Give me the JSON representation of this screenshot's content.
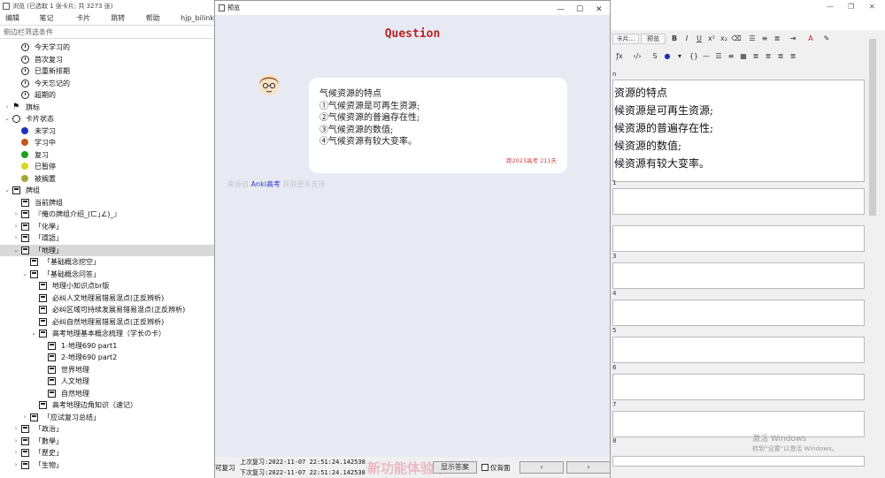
{
  "browser": {
    "title": "浏览 (已选取 1 张卡片; 共 3273 张)",
    "menu": [
      "编辑(E)",
      "笔记 (N)",
      "卡片(C)",
      "跳转(G)",
      "帮助(H)",
      "hjp_bilink"
    ],
    "sidebar_filter_placeholder": "侧边栏筛选条件",
    "tree": [
      {
        "label": "今天学习的",
        "icon": "clock-icon",
        "indent": 24
      },
      {
        "label": "首次复习",
        "icon": "clock-icon",
        "indent": 24
      },
      {
        "label": "已重新排期",
        "icon": "clock-icon",
        "indent": 24
      },
      {
        "label": "今天忘记的",
        "icon": "clock-icon",
        "indent": 24
      },
      {
        "label": "超期的",
        "icon": "clock-icon",
        "indent": 24
      },
      {
        "label": "旗标",
        "icon": "flag-icon",
        "indent": 14,
        "arrow": "›"
      },
      {
        "label": "卡片状态",
        "icon": "circle-icon",
        "indent": 14,
        "arrow": "⌄"
      },
      {
        "label": "未学习",
        "icon": "blue-dot-icon",
        "indent": 24
      },
      {
        "label": "学习中",
        "icon": "orange-dot-icon",
        "indent": 24
      },
      {
        "label": "复习",
        "icon": "green-dot-icon",
        "indent": 24
      },
      {
        "label": "已暂停",
        "icon": "yellow-dot-icon",
        "indent": 24
      },
      {
        "label": "被搁置",
        "icon": "olive-dot-icon",
        "indent": 24
      },
      {
        "label": "牌组",
        "icon": "deck-icon",
        "indent": 14,
        "arrow": "⌄"
      },
      {
        "label": "当前牌组",
        "icon": "current-deck-icon",
        "indent": 24
      },
      {
        "label": "『俺の牌组介绍_(ㄈ｣∠)_』",
        "icon": "deck-icon",
        "indent": 24,
        "arrow": "›"
      },
      {
        "label": "「化學」",
        "icon": "deck-icon",
        "indent": 24,
        "arrow": "›"
      },
      {
        "label": "「環語」",
        "icon": "deck-icon",
        "indent": 24,
        "arrow": "›"
      },
      {
        "label": "「地理」",
        "icon": "deck-icon",
        "indent": 24,
        "arrow": "⌄",
        "selected": true
      },
      {
        "label": "「基础概念挖空」",
        "icon": "deck-icon",
        "indent": 34
      },
      {
        "label": "「基础概念问答」",
        "icon": "deck-icon",
        "indent": 34,
        "arrow": "⌄"
      },
      {
        "label": "地理小知识点br版",
        "icon": "deck-icon",
        "indent": 44
      },
      {
        "label": "必纠人文地理易错易混点(正反辨析)",
        "icon": "deck-icon",
        "indent": 44
      },
      {
        "label": "必纠区域可持续发展易错易混点(正反辨析)",
        "icon": "deck-icon",
        "indent": 44
      },
      {
        "label": "必纠自然地理易错易混点(正反辨析)",
        "icon": "deck-icon",
        "indent": 44
      },
      {
        "label": "高考地理基本概念梳理（学长の卡）",
        "icon": "deck-icon",
        "indent": 44,
        "arrow": "⌄"
      },
      {
        "label": "1-地理690 part1",
        "icon": "deck-icon",
        "indent": 54
      },
      {
        "label": "2-地理690 part2",
        "icon": "deck-icon",
        "indent": 54
      },
      {
        "label": "世界地理",
        "icon": "deck-icon",
        "indent": 54
      },
      {
        "label": "人文地理",
        "icon": "deck-icon",
        "indent": 54
      },
      {
        "label": "自然地理",
        "icon": "deck-icon",
        "indent": 54
      },
      {
        "label": "高考地理边角知识（速记）",
        "icon": "deck-icon",
        "indent": 44
      },
      {
        "label": "「应试复习总结」",
        "icon": "deck-icon",
        "indent": 34,
        "arrow": "›"
      },
      {
        "label": "「政治」",
        "icon": "deck-icon",
        "indent": 24,
        "arrow": "›"
      },
      {
        "label": "「數學」",
        "icon": "deck-icon",
        "indent": 24,
        "arrow": "›"
      },
      {
        "label": "「歷史」",
        "icon": "deck-icon",
        "indent": 24,
        "arrow": "›"
      },
      {
        "label": "「生物」",
        "icon": "deck-icon",
        "indent": 24,
        "arrow": "›"
      }
    ],
    "colors": {
      "blue": "#1b2fb8",
      "orange": "#c0561b",
      "green": "#1aa01a",
      "yellow": "#d8d81f",
      "olive": "#a4a43a"
    }
  },
  "preview": {
    "title": "预览",
    "heading": "Question",
    "question_lines": [
      "气候资源的特点",
      "①气候资源是可再生资源;",
      "②气候资源的普遍存在性;",
      "③气候资源的数值;",
      "④气候资源有较大变率。"
    ],
    "meta": "距2023高考 211天",
    "source_prefix": "来源自",
    "source_link": "Anki高考",
    "source_suffix": "获取更多支持",
    "bottom": {
      "label_left": "可复习",
      "last_review_1": "上次复习:2022-11-07 22:51:24.142538",
      "last_review_2": "下次复习:2022-11-07 22:51:24.142538",
      "watermark": "新功能体验中",
      "btn_answer": "显示答案",
      "chk_back_only": "仅背面",
      "btn_prev": "‹",
      "btn_next": "›"
    },
    "accent": "#b82222"
  },
  "editor": {
    "top_buttons": [
      "卡片...",
      "预览"
    ],
    "front_lines": [
      "资源的特点",
      "候资源是可再生资源;",
      "候资源的普遍存在性;",
      "候资源的数值;",
      "候资源有较大变率。"
    ],
    "field_numbers": [
      "1",
      "3",
      "4",
      "5",
      "6",
      "7",
      "8"
    ],
    "field_first": "n",
    "watermark_title": "激活 Windows",
    "watermark_sub": "转到“设置”以激活 Windows。"
  }
}
